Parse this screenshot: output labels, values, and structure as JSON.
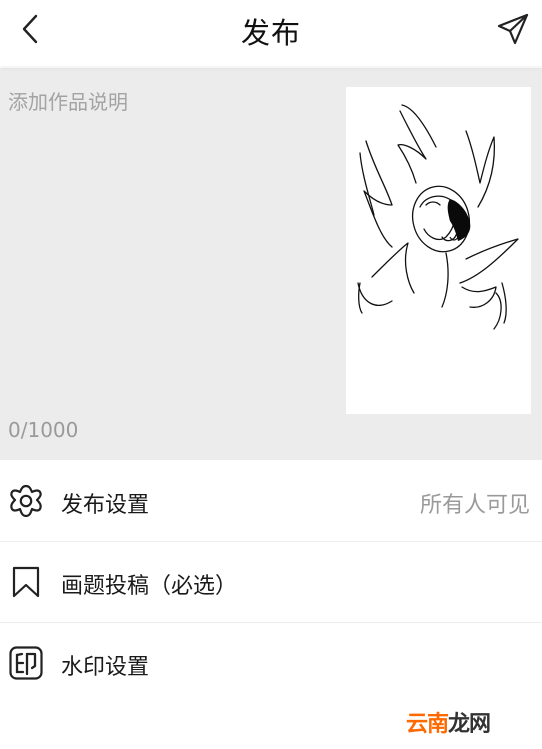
{
  "header": {
    "title": "发布"
  },
  "editor": {
    "placeholder": "添加作品说明",
    "value": "",
    "counter": "0/1000"
  },
  "settings": [
    {
      "label": "发布设置",
      "value": "所有人可见",
      "icon": "gear-flower-icon"
    },
    {
      "label": "画题投稿（必选）",
      "icon": "bookmark-icon"
    },
    {
      "label": "水印设置",
      "icon": "seal-stamp-icon"
    }
  ],
  "watermark": {
    "part1": "云南",
    "part2": "龙网",
    "colors": {
      "part1": "#ff6a00",
      "part2": "#333333"
    }
  }
}
